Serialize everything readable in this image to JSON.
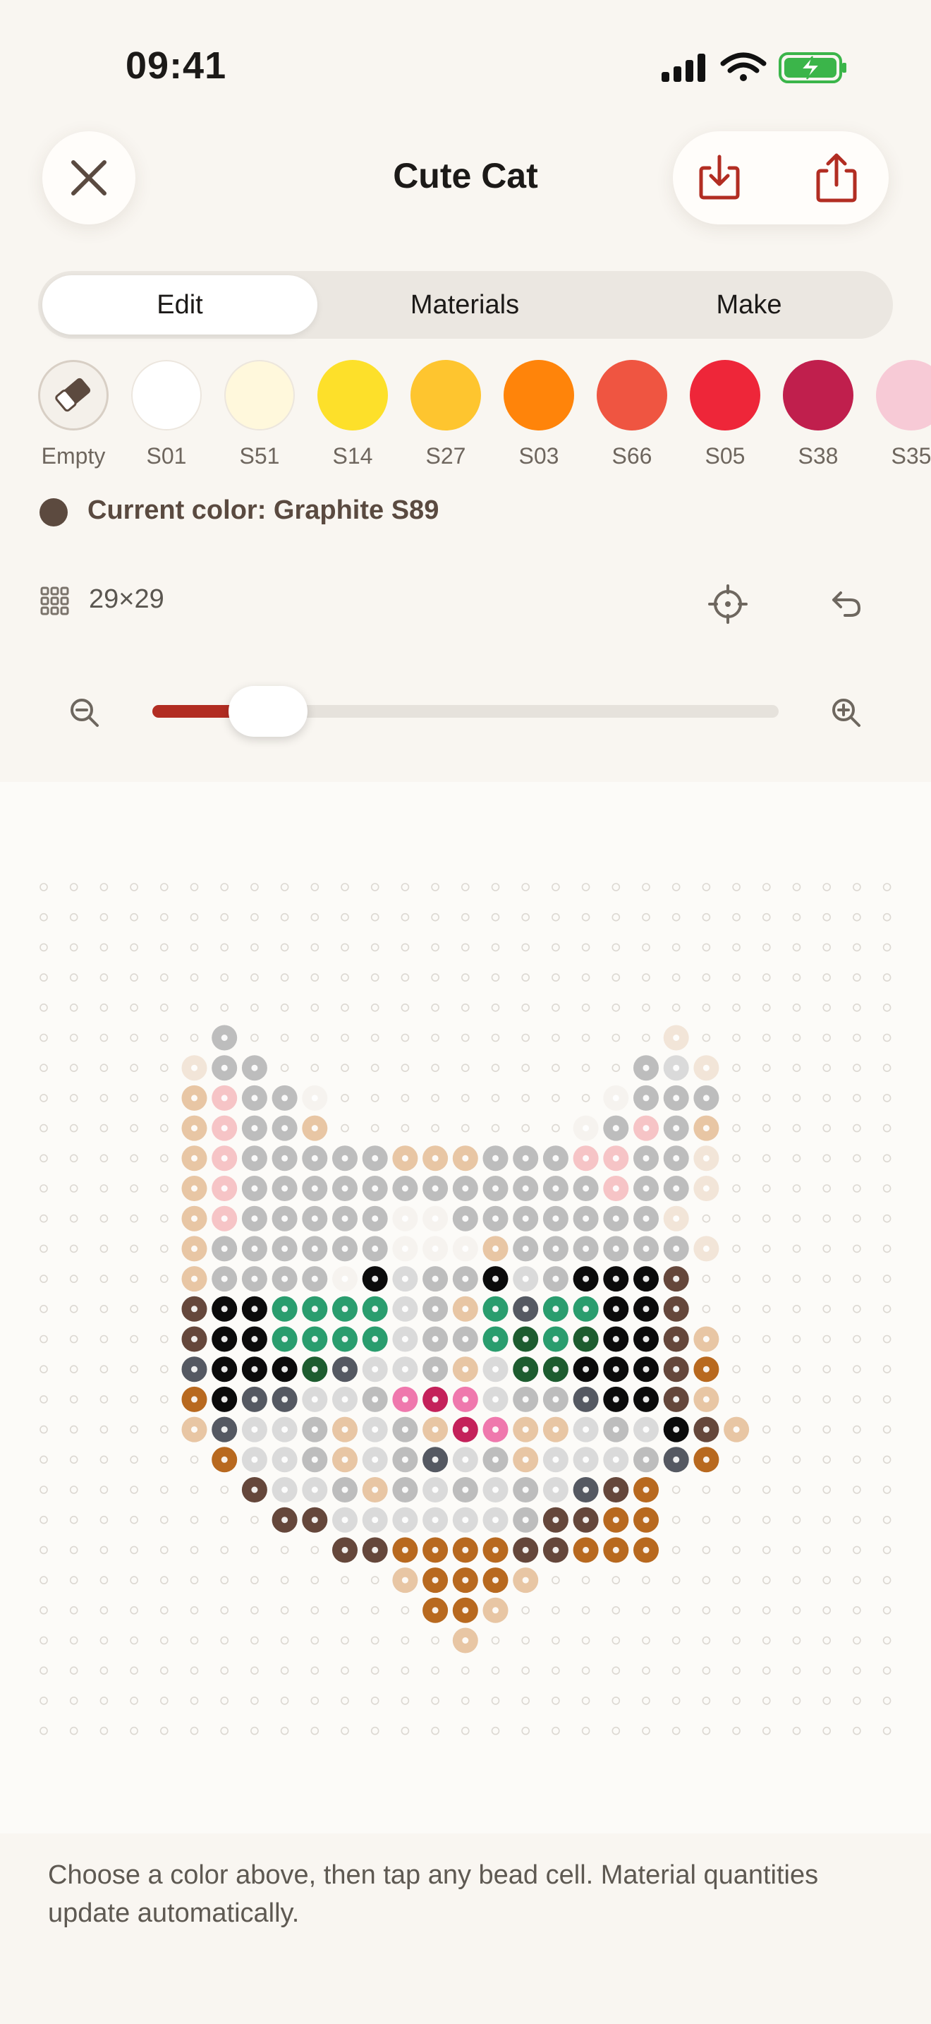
{
  "status": {
    "time": "09:41"
  },
  "header": {
    "title": "Cute Cat"
  },
  "tabs": [
    {
      "label": "Edit",
      "active": true
    },
    {
      "label": "Materials",
      "active": false
    },
    {
      "label": "Make",
      "active": false
    }
  ],
  "palette": [
    {
      "label": "Empty",
      "color": "#f4f0ea",
      "icon": "eraser-icon",
      "selected": true
    },
    {
      "label": "S01",
      "color": "#ffffff"
    },
    {
      "label": "S51",
      "color": "#fff8dc"
    },
    {
      "label": "S14",
      "color": "#fde02a"
    },
    {
      "label": "S27",
      "color": "#fec52f"
    },
    {
      "label": "S03",
      "color": "#ff840a"
    },
    {
      "label": "S66",
      "color": "#ef5541"
    },
    {
      "label": "S05",
      "color": "#ee2639"
    },
    {
      "label": "S38",
      "color": "#c01f4d"
    },
    {
      "label": "S35",
      "color": "#f7cad6"
    }
  ],
  "current_color": {
    "text": "Current color: Graphite S89",
    "color": "#5c4a3f"
  },
  "grid": {
    "size_label": "29×29",
    "rows": 29,
    "cols": 29,
    "colors": {
      "W": "#f6f3ef",
      "w": "#f2e5d8",
      "g": "#bdbdbd",
      "p": "#f6c4c6",
      "t": "#e8c6a4",
      "K": "#0b0b0b",
      "n": "#65473b",
      "G": "#2a9d6e",
      "D": "#1d5c2f",
      "s": "#555962",
      "o": "#b8691f",
      "r": "#c4215a",
      "k": "#ef78ad",
      "c": "#dadada"
    },
    "pattern": [
      "",
      "",
      "",
      "",
      "",
      "     .g..............w.      ",
      "     wgg............gcw      ",
      "     tpggW.........Wggg      ",
      "     tpggt........Wgpgt      ",
      "     tpgggggtttgggppggw      ",
      "     tpggggggggggggpggw      ",
      "     tpgggggWWgggggggw       ",
      "     tggggggWWWtggggggw      ",
      "     tggggWKcggKcgKKKn       ",
      "     nKKGGGGcgtGsGGKKn       ",
      "     nKKGGGGcggGDGDKKnt      ",
      "     sKKKDsccgtcDDKKKno      ",
      "     oKssccgkrkcggsKKnt      ",
      "     tsccgtcgtrkttcgcKnt     ",
      "      occgtcgscgtcccgso     ",
      "       nccgtgcgcgcsno      ",
      "        nnccccccgnnoo       ",
      "          nnoooonnooo        ",
      "            tooot            ",
      "             oot             ",
      "              t              ",
      "",
      "",
      ""
    ]
  },
  "hint": "Choose a color above, then tap any bead cell. Material quantities update automatically.",
  "zoom_level": 0.14
}
